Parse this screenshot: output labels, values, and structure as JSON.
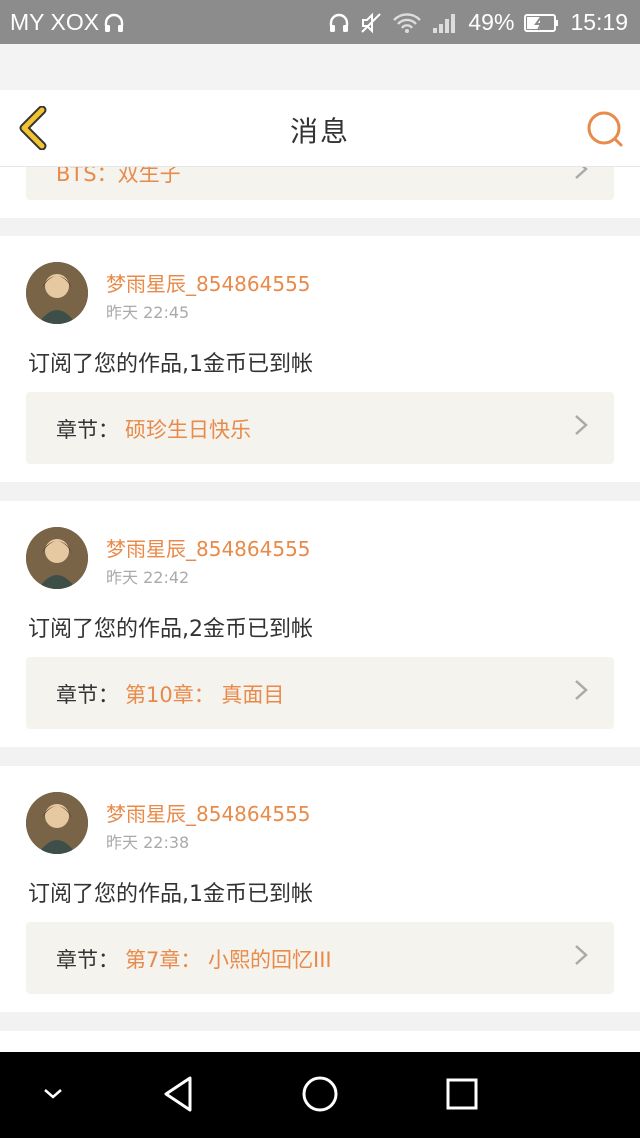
{
  "statusbar": {
    "carrier": "MY XOX",
    "battery": "49%",
    "time": "15:19"
  },
  "header": {
    "title": "消息"
  },
  "partial_chapter": {
    "label": "BTS：双生子"
  },
  "messages": [
    {
      "username": "梦雨星辰_854864555",
      "time": "昨天 22:45",
      "text": "订阅了您的作品,1金币已到帐",
      "chapter_label": "章节：",
      "chapter_name": "硕珍生日快乐"
    },
    {
      "username": "梦雨星辰_854864555",
      "time": "昨天 22:42",
      "text": "订阅了您的作品,2金币已到帐",
      "chapter_label": "章节：",
      "chapter_name": "第10章： 真面目"
    },
    {
      "username": "梦雨星辰_854864555",
      "time": "昨天 22:38",
      "text": "订阅了您的作品,1金币已到帐",
      "chapter_label": "章节：",
      "chapter_name": "第7章： 小熙的回忆III"
    }
  ],
  "colors": {
    "accent": "#e88a4a",
    "back_icon": "#f2c230"
  }
}
